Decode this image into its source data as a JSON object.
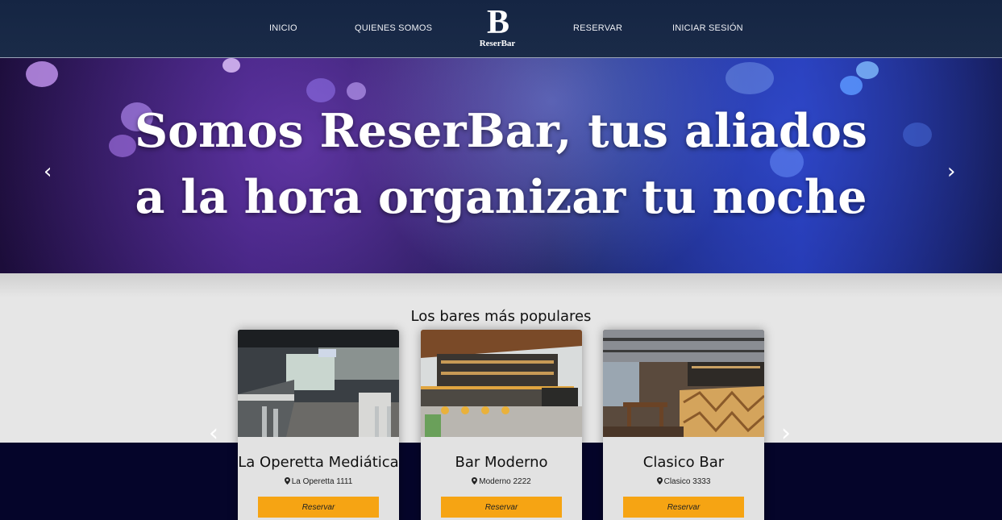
{
  "nav": {
    "inicio": "INICIO",
    "quienes": "QUIENES SOMOS",
    "logo_letter": "B",
    "logo_text": "ReserBar",
    "reservar": "RESERVAR",
    "login": "INICIAR SESIÓN"
  },
  "hero": {
    "line1": "Somos ReserBar, tus aliados",
    "line2": "a la hora organizar tu noche",
    "prev": "‹",
    "next": "›"
  },
  "popular": {
    "title": "Los bares más populares",
    "prev": "‹",
    "next": "›",
    "cards": [
      {
        "name": "La Operetta Mediática",
        "address": "La Operetta 1111",
        "button": "Reservar"
      },
      {
        "name": "Bar Moderno",
        "address": "Moderno 2222",
        "button": "Reservar"
      },
      {
        "name": "Clasico Bar",
        "address": "Clasico 3333",
        "button": "Reservar"
      }
    ]
  },
  "colors": {
    "nav_bg": "#152543",
    "button": "#f6a413",
    "bottom_band": "#05052a"
  },
  "icons": [
    "chevron-left-icon",
    "chevron-right-icon",
    "map-pin-icon",
    "reserbar-logo"
  ]
}
